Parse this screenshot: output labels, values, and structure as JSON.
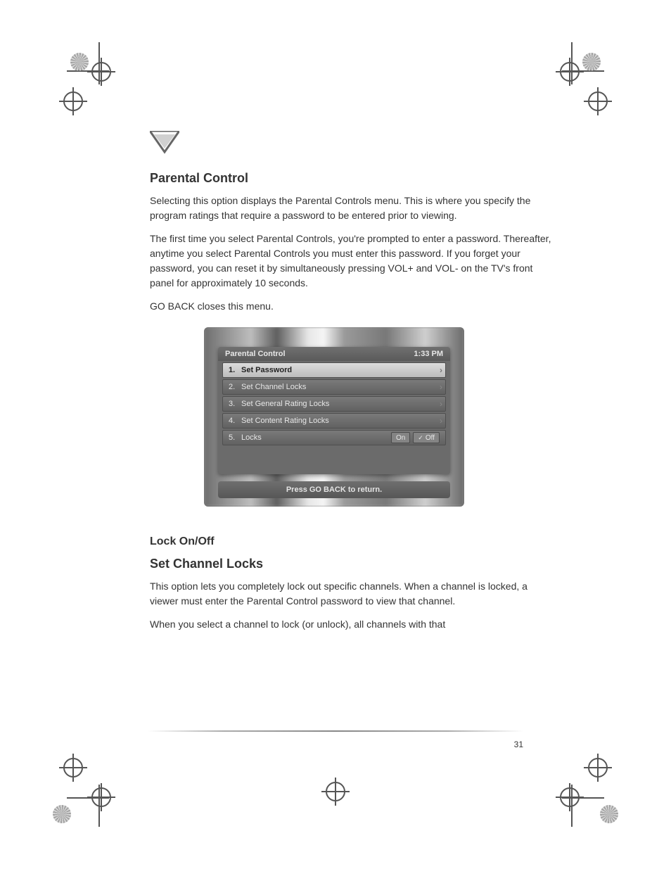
{
  "document": {
    "section_title": "Parental Control",
    "subhead_lock_onoff": "Lock On/Off",
    "p1": "Selecting this option displays the Parental Controls menu. This is where you specify the program ratings that require a password to be entered prior to viewing.",
    "p2": "The first time you select Parental Controls, you're prompted to enter a password. Thereafter, anytime you select Parental Controls you must enter this password. If you forget your password, you can reset it by simultaneously pressing VOL+ and VOL- on the TV's front panel for approximately 10 seconds.",
    "p3": "GO BACK closes this menu.",
    "subhead_set_channel": "Set Channel Locks",
    "p4": "This option lets you completely lock out specific channels. When a channel is locked, a viewer must enter the Parental Control password to view that channel.",
    "p5": "When you select a channel to lock (or unlock), all channels with that"
  },
  "tv": {
    "title": "Parental Control",
    "clock": "1:33 PM",
    "rows": [
      {
        "num": "1.",
        "label": "Set Password",
        "selected": true
      },
      {
        "num": "2.",
        "label": "Set Channel Locks"
      },
      {
        "num": "3.",
        "label": "Set General Rating Locks"
      },
      {
        "num": "4.",
        "label": "Set Content Rating Locks"
      },
      {
        "num": "5.",
        "label": "Locks",
        "toggle": {
          "on": "On",
          "off": "Off",
          "state": "off"
        }
      }
    ],
    "footer": "Press GO BACK to return."
  },
  "page_number": "31"
}
